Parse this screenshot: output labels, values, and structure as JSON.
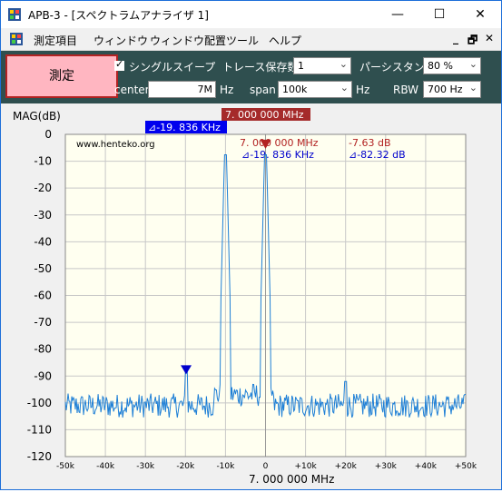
{
  "window": {
    "title": "APB-3 - [スペクトラムアナライザ 1]",
    "minimize_icon": "minimize-icon",
    "maximize_icon": "maximize-icon",
    "close_icon": "close-icon"
  },
  "menu": {
    "items": [
      "測定項目",
      "ウィンドウ",
      "ウィンドウ配置",
      "ツール",
      "ヘルプ"
    ],
    "mdi_minimize": "_",
    "mdi_restore": "🗗",
    "mdi_close": "✕"
  },
  "panel": {
    "measure_label": "測定",
    "single_sweep_label": "シングルスイープ",
    "single_sweep_checked": true,
    "trace_save_label": "トレース保存数",
    "trace_save_value": "1",
    "persistence_label": "パーシスタンス",
    "persistence_value": "80 %",
    "center_label": "center",
    "center_value": "7M",
    "center_unit": "Hz",
    "span_label": "span",
    "span_value": "100k",
    "span_unit": "Hz",
    "rbw_label": "RBW",
    "rbw_value": "700 Hz"
  },
  "chart_data": {
    "type": "line",
    "ylabel": "MAG(dB)",
    "xlabel": "7. 000 000 MHz",
    "watermark": "www.henteko.org",
    "ylim": [
      -120,
      0
    ],
    "xlim": [
      -50,
      50
    ],
    "y_ticks": [
      "0",
      "-10",
      "-20",
      "-30",
      "-40",
      "-50",
      "-60",
      "-70",
      "-80",
      "-90",
      "-100",
      "-110",
      "-120"
    ],
    "x_ticks": [
      "-50k",
      "-40k",
      "-30k",
      "-20k",
      "-10k",
      "0",
      "+10k",
      "+20k",
      "+30k",
      "+40k",
      "+50k"
    ],
    "x_tick_values": [
      -50,
      -40,
      -30,
      -20,
      -10,
      0,
      10,
      20,
      30,
      40,
      50
    ],
    "grid": true,
    "background": "#fffff0",
    "trace_color": "#1e7fd6",
    "marker1": {
      "label_top": "7. 000 000 MHz",
      "freq_text": "7. 000 000 MHz",
      "level_text": "-7.63 dB",
      "x": 0,
      "y": -4,
      "color": "#b22222"
    },
    "marker2": {
      "label_top": "⊿-19. 836 KHz",
      "freq_text": "⊿-19. 836 KHz",
      "level_text": "⊿-82.32 dB",
      "x": -19.836,
      "y": -88,
      "color": "#0000cc"
    },
    "peaks": [
      {
        "x": -10,
        "y": -7.6
      },
      {
        "x": 0,
        "y": -7.6
      }
    ],
    "noise_floor": -101
  }
}
